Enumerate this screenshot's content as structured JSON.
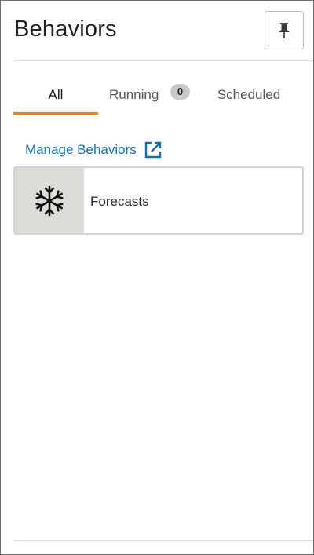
{
  "header": {
    "title": "Behaviors",
    "pin_icon": "pin-icon"
  },
  "tabs": [
    {
      "label": "All",
      "selected": true
    },
    {
      "label": "Running",
      "badge": "0",
      "selected": false
    },
    {
      "label": "Scheduled",
      "selected": false
    }
  ],
  "manage_link": {
    "label": "Manage Behaviors",
    "icon": "external-link-icon"
  },
  "behaviors": [
    {
      "label": "Forecasts",
      "icon": "snowflake-icon"
    }
  ],
  "colors": {
    "accent": "#e8800f",
    "link": "#1670a8",
    "badge_bg": "#c9c9c9",
    "card_icon_bg": "#dcdcd8"
  }
}
